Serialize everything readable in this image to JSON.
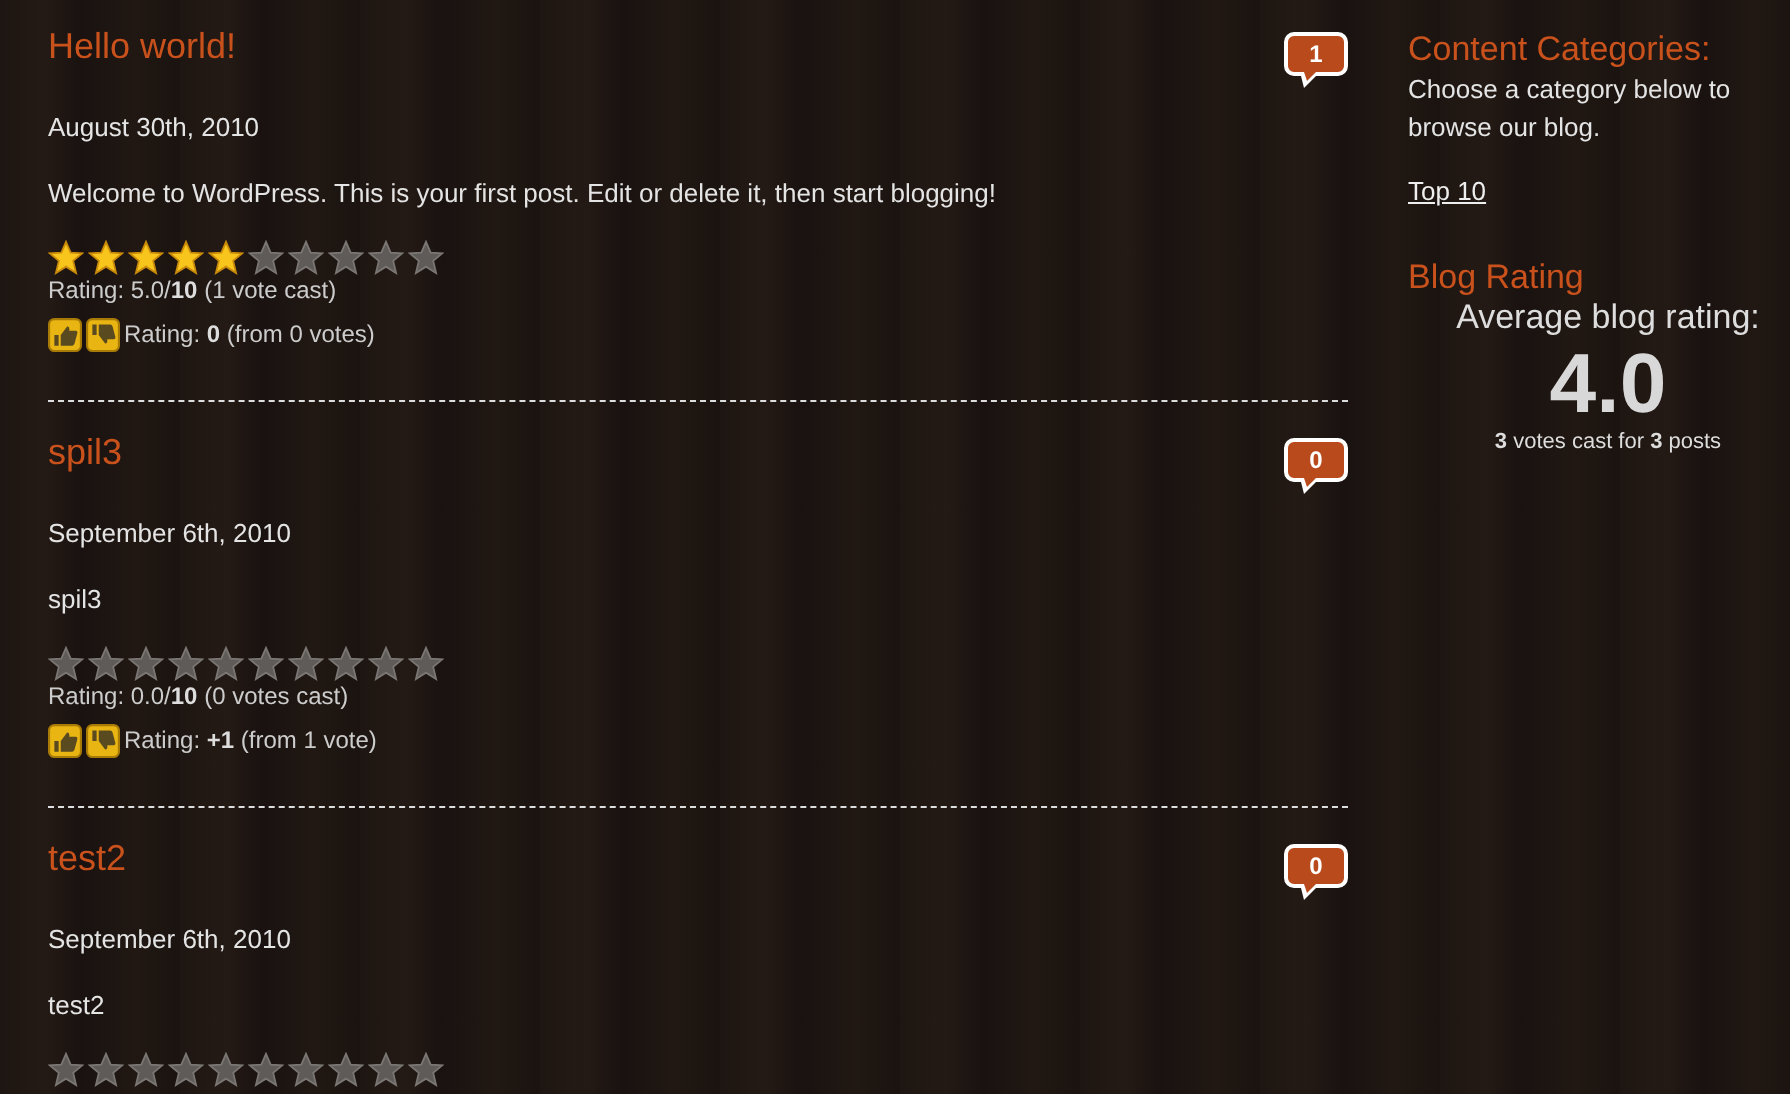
{
  "posts": [
    {
      "title": "Hello world!",
      "comments": "1",
      "date": "August 30th, 2010",
      "body": "Welcome to WordPress. This is your first post. Edit or delete it, then start blogging!",
      "stars": 5,
      "rating": "Rating: 5.0/**10** (1 vote cast)",
      "thumbs_rating": "Rating: **0** (from 0 votes)"
    },
    {
      "title": "spil3",
      "comments": "0",
      "date": "September 6th, 2010",
      "body": "spil3",
      "stars": 0,
      "rating": "Rating: 0.0/**10** (0 votes cast)",
      "thumbs_rating": "Rating: **+1** (from 1 vote)"
    },
    {
      "title": "test2",
      "comments": "0",
      "date": "September 6th, 2010",
      "body": "test2",
      "stars": 0
    }
  ],
  "sidebar": {
    "categories": {
      "title": "Content Categories:",
      "description": "Choose a category below to browse our blog.",
      "links": [
        "Top 10"
      ]
    },
    "blog_rating": {
      "title": "Blog Rating",
      "label": "Average blog rating:",
      "value": "4.0",
      "summary": "**3** votes cast for **3** posts"
    }
  }
}
